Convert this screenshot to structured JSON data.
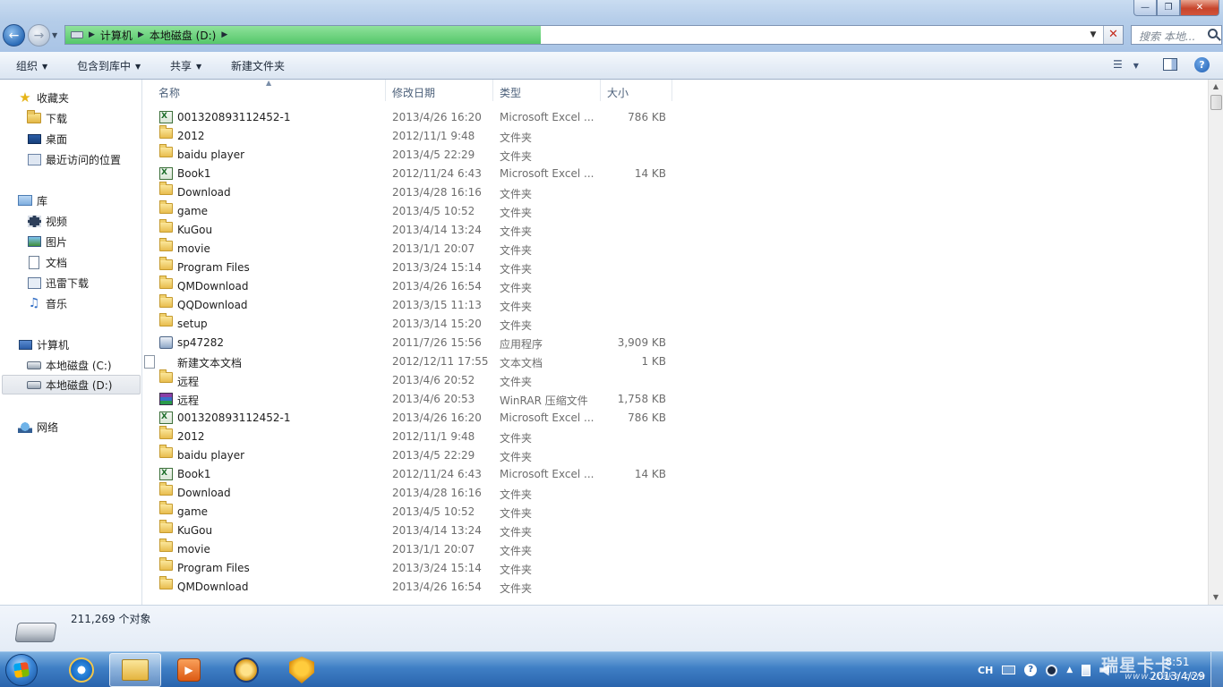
{
  "window": {
    "controls": [
      "—",
      "❐",
      "✕"
    ]
  },
  "address": {
    "crumbs": [
      "计算机",
      "本地磁盘 (D:)"
    ],
    "progress": 0.45,
    "search_placeholder": "搜索 本地..."
  },
  "toolbar": {
    "organize": "组织",
    "include_in_library": "包含到库中",
    "share": "共享",
    "new_folder": "新建文件夹"
  },
  "nav": {
    "favorites_label": "收藏夹",
    "favorites": [
      "下载",
      "桌面",
      "最近访问的位置"
    ],
    "libraries_label": "库",
    "libraries": [
      "视频",
      "图片",
      "文档",
      "迅雷下载",
      "音乐"
    ],
    "computer_label": "计算机",
    "drives": [
      "本地磁盘 (C:)",
      "本地磁盘 (D:)"
    ],
    "selected_drive": "本地磁盘 (D:)",
    "network_label": "网络"
  },
  "columns": {
    "name": "名称",
    "modified": "修改日期",
    "type": "类型",
    "size": "大小"
  },
  "files": [
    {
      "icon": "excel",
      "name": "001320893112452-1",
      "modified": "2013/4/26 16:20",
      "type": "Microsoft Excel ...",
      "size": "786 KB"
    },
    {
      "icon": "folder",
      "name": "2012",
      "modified": "2012/11/1 9:48",
      "type": "文件夹",
      "size": ""
    },
    {
      "icon": "folder",
      "name": "baidu player",
      "modified": "2013/4/5 22:29",
      "type": "文件夹",
      "size": ""
    },
    {
      "icon": "excel",
      "name": "Book1",
      "modified": "2012/11/24 6:43",
      "type": "Microsoft Excel ...",
      "size": "14 KB"
    },
    {
      "icon": "folder",
      "name": "Download",
      "modified": "2013/4/28 16:16",
      "type": "文件夹",
      "size": ""
    },
    {
      "icon": "folder",
      "name": "game",
      "modified": "2013/4/5 10:52",
      "type": "文件夹",
      "size": ""
    },
    {
      "icon": "folder",
      "name": "KuGou",
      "modified": "2013/4/14 13:24",
      "type": "文件夹",
      "size": ""
    },
    {
      "icon": "folder",
      "name": "movie",
      "modified": "2013/1/1 20:07",
      "type": "文件夹",
      "size": ""
    },
    {
      "icon": "folder",
      "name": "Program Files",
      "modified": "2013/3/24 15:14",
      "type": "文件夹",
      "size": ""
    },
    {
      "icon": "folder",
      "name": "QMDownload",
      "modified": "2013/4/26 16:54",
      "type": "文件夹",
      "size": ""
    },
    {
      "icon": "folder",
      "name": "QQDownload",
      "modified": "2013/3/15 11:13",
      "type": "文件夹",
      "size": ""
    },
    {
      "icon": "folder",
      "name": "setup",
      "modified": "2013/3/14 15:20",
      "type": "文件夹",
      "size": ""
    },
    {
      "icon": "exe",
      "name": "sp47282",
      "modified": "2011/7/26 15:56",
      "type": "应用程序",
      "size": "3,909 KB"
    },
    {
      "icon": "txt",
      "name": "新建文本文档",
      "modified": "2012/12/11 17:55",
      "type": "文本文档",
      "size": "1 KB"
    },
    {
      "icon": "folder",
      "name": "远程",
      "modified": "2013/4/6 20:52",
      "type": "文件夹",
      "size": ""
    },
    {
      "icon": "rar",
      "name": "远程",
      "modified": "2013/4/6 20:53",
      "type": "WinRAR 压缩文件",
      "size": "1,758 KB"
    },
    {
      "icon": "excel",
      "name": "001320893112452-1",
      "modified": "2013/4/26 16:20",
      "type": "Microsoft Excel ...",
      "size": "786 KB"
    },
    {
      "icon": "folder",
      "name": "2012",
      "modified": "2012/11/1 9:48",
      "type": "文件夹",
      "size": ""
    },
    {
      "icon": "folder",
      "name": "baidu player",
      "modified": "2013/4/5 22:29",
      "type": "文件夹",
      "size": ""
    },
    {
      "icon": "excel",
      "name": "Book1",
      "modified": "2012/11/24 6:43",
      "type": "Microsoft Excel ...",
      "size": "14 KB"
    },
    {
      "icon": "folder",
      "name": "Download",
      "modified": "2013/4/28 16:16",
      "type": "文件夹",
      "size": ""
    },
    {
      "icon": "folder",
      "name": "game",
      "modified": "2013/4/5 10:52",
      "type": "文件夹",
      "size": ""
    },
    {
      "icon": "folder",
      "name": "KuGou",
      "modified": "2013/4/14 13:24",
      "type": "文件夹",
      "size": ""
    },
    {
      "icon": "folder",
      "name": "movie",
      "modified": "2013/1/1 20:07",
      "type": "文件夹",
      "size": ""
    },
    {
      "icon": "folder",
      "name": "Program Files",
      "modified": "2013/3/24 15:14",
      "type": "文件夹",
      "size": ""
    },
    {
      "icon": "folder",
      "name": "QMDownload",
      "modified": "2013/4/26 16:54",
      "type": "文件夹",
      "size": ""
    }
  ],
  "details": {
    "object_count": "211,269 个对象"
  },
  "taskbar": {
    "tray_ime": "CH",
    "time": "8:51",
    "date": "2013/4/29",
    "watermark": "瑞星卡卡",
    "watermark_sub": "www.ikaka.com"
  }
}
